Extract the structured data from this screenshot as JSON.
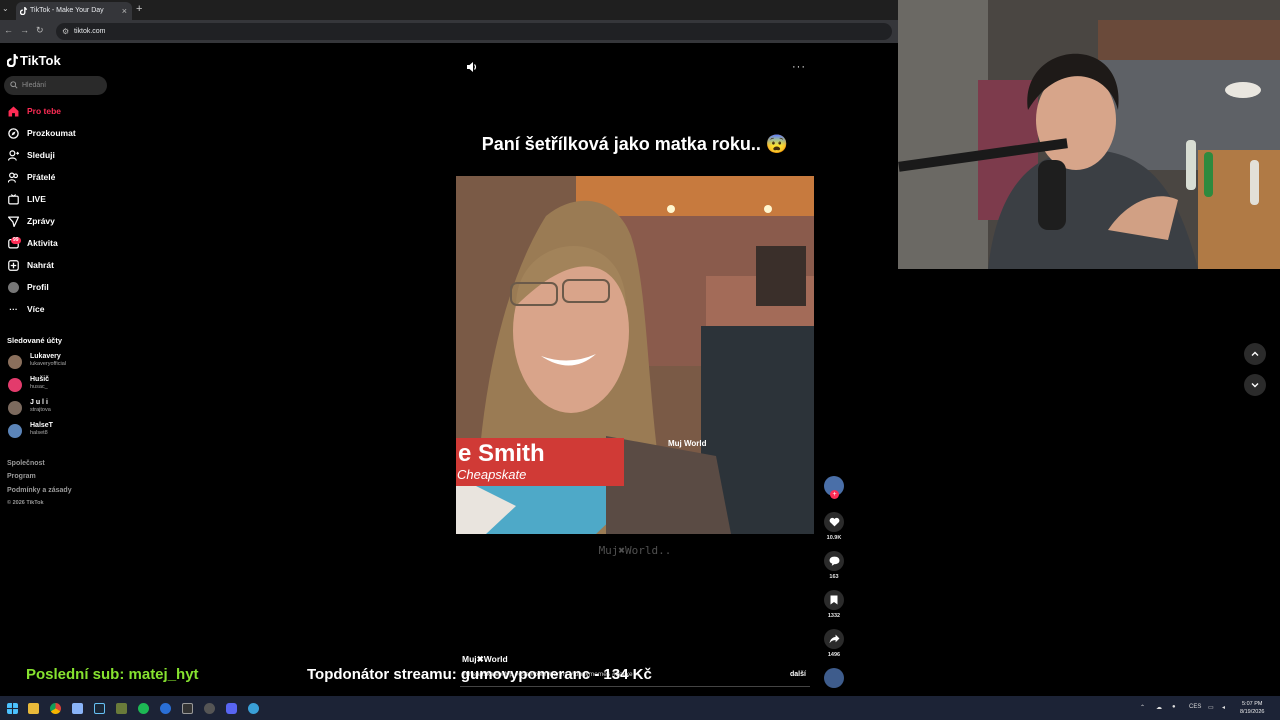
{
  "browser": {
    "tab_title": "TikTok - Make Your Day",
    "tab_close": "×",
    "new_tab": "+",
    "url": "tiktok.com"
  },
  "tiktok": {
    "logo_text": "TikTok",
    "search_placeholder": "Hledání",
    "nav": [
      {
        "label": "Pro tebe",
        "icon": "home-icon"
      },
      {
        "label": "Prozkoumat",
        "icon": "compass-icon"
      },
      {
        "label": "Sleduji",
        "icon": "user-follow-icon"
      },
      {
        "label": "Přátelé",
        "icon": "friends-icon"
      },
      {
        "label": "LIVE",
        "icon": "live-icon"
      },
      {
        "label": "Zprávy",
        "icon": "message-icon"
      },
      {
        "label": "Aktivita",
        "icon": "activity-icon",
        "badge": "99"
      },
      {
        "label": "Nahrát",
        "icon": "upload-icon"
      },
      {
        "label": "Profil",
        "icon": "profile-icon"
      },
      {
        "label": "Více",
        "icon": "more-icon"
      }
    ],
    "followed_title": "Sledované účty",
    "followed": [
      {
        "name": "Lukavery",
        "handle": "lukaveryofficial"
      },
      {
        "name": "Hušič",
        "handle": "husac_"
      },
      {
        "name": "J u l i",
        "handle": "strajtova"
      },
      {
        "name": "HalseT",
        "handle": "halset8"
      }
    ],
    "footer": [
      "Společnost",
      "Program",
      "Podmínky a zásady"
    ],
    "copyright": "© 2026 TikTok"
  },
  "video": {
    "caption": "Paní šetřílková jako matka roku.. 😨",
    "lower_third_name": "e Smith",
    "lower_third_sub": "Cheapskate",
    "in_video_watermark": "Muj  World",
    "under_watermark": "Muj✖World..",
    "author": "Muj✖World",
    "description": "#cheapskate #fyp #usa #bike #funny #funnymemes #belike ...",
    "more_link": "další",
    "likes": "10.9K",
    "comments": "163",
    "saves": "1332",
    "shares": "1496"
  },
  "overlay": {
    "last_sub": "Poslední sub: matej_hyt",
    "top_donor": "Topdonátor streamu: gumovypomeranc - 134 Kč"
  },
  "taskbar": {
    "lang": "CES",
    "time": "5:07 PM",
    "date": "8/19/2026"
  }
}
